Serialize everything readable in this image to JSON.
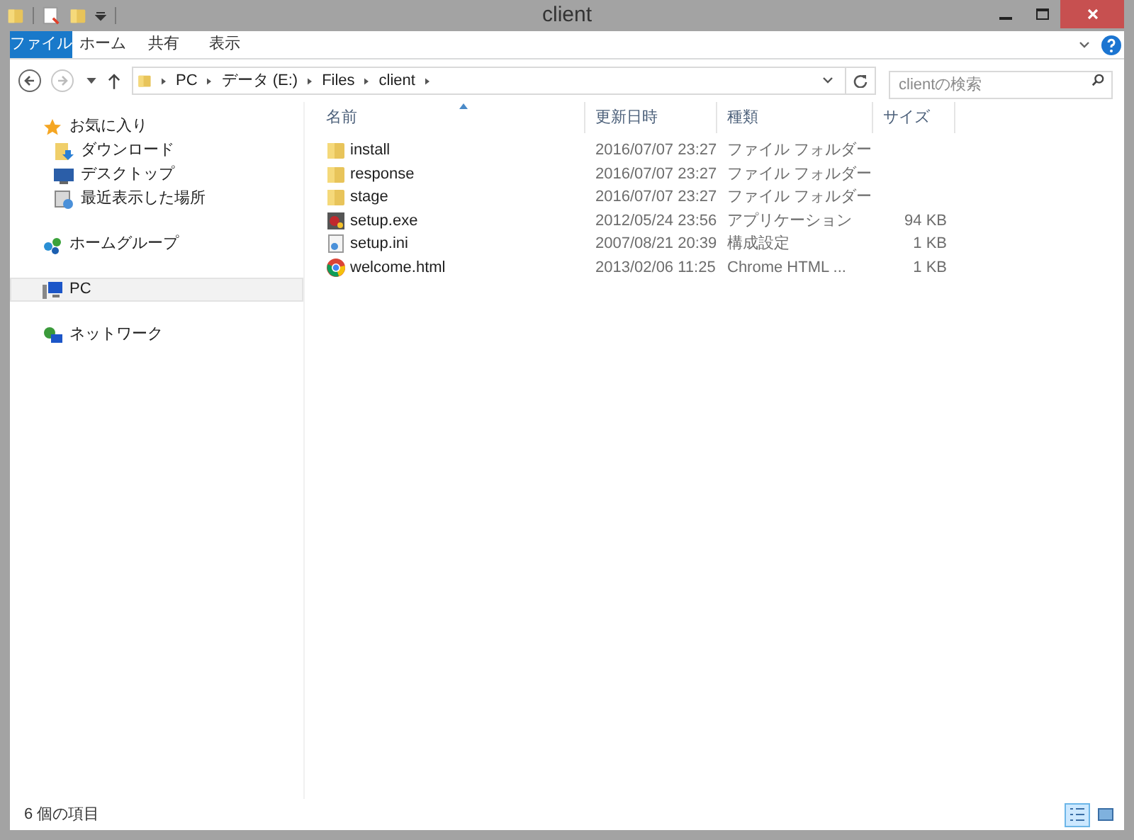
{
  "window": {
    "title": "client"
  },
  "ribbon_tabs": [
    {
      "label": "ファイル",
      "kind": "file"
    },
    {
      "label": "ホーム",
      "kind": "tab"
    },
    {
      "label": "共有",
      "kind": "tab"
    },
    {
      "label": "表示",
      "kind": "tab"
    }
  ],
  "address": {
    "segments": [
      "PC",
      "データ (E:)",
      "Files",
      "client"
    ]
  },
  "search": {
    "placeholder": "clientの検索"
  },
  "sidebar": {
    "items": [
      {
        "label": "お気に入り",
        "kind": "star",
        "selected": false,
        "children": [
          {
            "label": "ダウンロード",
            "kind": "download",
            "selected": false
          },
          {
            "label": "デスクトップ",
            "kind": "desktop",
            "selected": false
          },
          {
            "label": "最近表示した場所",
            "kind": "recent",
            "selected": false
          }
        ]
      },
      {
        "label": "ホームグループ",
        "kind": "homegroup",
        "selected": false
      },
      {
        "label": "PC",
        "kind": "pc",
        "selected": true
      },
      {
        "label": "ネットワーク",
        "kind": "network",
        "selected": false
      }
    ]
  },
  "table": {
    "columns": [
      "名前",
      "更新日時",
      "種類",
      "サイズ"
    ],
    "rows": [
      {
        "kind": "folder",
        "name": "install",
        "date": "2016/07/07 23:27",
        "type": "ファイル フォルダー"
      },
      {
        "kind": "folder",
        "name": "response",
        "date": "2016/07/07 23:27",
        "type": "ファイル フォルダー"
      },
      {
        "kind": "folder",
        "name": "stage",
        "date": "2016/07/07 23:27",
        "type": "ファイル フォルダー"
      },
      {
        "kind": "exe",
        "name": "setup.exe",
        "date": "2012/05/24 23:56",
        "type": "アプリケーション",
        "size": "94 KB"
      },
      {
        "kind": "ini",
        "name": "setup.ini",
        "date": "2007/08/21 20:39",
        "type": "構成設定",
        "size": "1 KB"
      },
      {
        "kind": "html",
        "name": "welcome.html",
        "date": "2013/02/06 11:25",
        "type": "Chrome HTML ...",
        "size": "1 KB"
      }
    ]
  },
  "status_bar": {
    "text": "6 個の項目",
    "views": [
      {
        "kind": "details",
        "selected": true
      },
      {
        "kind": "thumbnails",
        "selected": false
      }
    ]
  }
}
